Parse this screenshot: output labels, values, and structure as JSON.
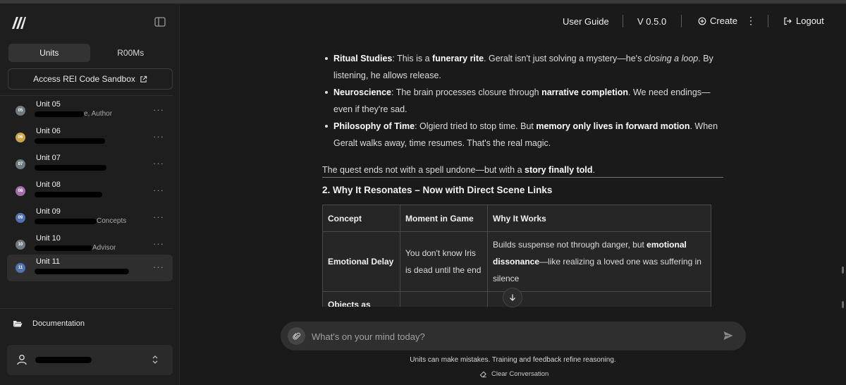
{
  "sidebar": {
    "tabs": [
      "Units",
      "R00Ms"
    ],
    "sandbox_label": "Access REI Code Sandbox",
    "units": [
      {
        "badge": "05",
        "name": "Unit 05",
        "subtitle": "e, Author",
        "color": "#6f7b80"
      },
      {
        "badge": "06",
        "name": "Unit 06",
        "subtitle": "",
        "color": "#c9a64a"
      },
      {
        "badge": "07",
        "name": "Unit 07",
        "subtitle": "",
        "color": "#6f7b80"
      },
      {
        "badge": "08",
        "name": "Unit 08",
        "subtitle": "",
        "color": "#a46fa8"
      },
      {
        "badge": "09",
        "name": "Unit 09",
        "subtitle": "Concepts",
        "color": "#4f74b0"
      },
      {
        "badge": "10",
        "name": "Unit 10",
        "subtitle": "Advisor",
        "color": "#6f7b80"
      },
      {
        "badge": "11",
        "name": "Unit 11",
        "subtitle": "",
        "color": "#4f74b0"
      }
    ],
    "documentation_label": "Documentation"
  },
  "nav": {
    "user_guide": "User Guide",
    "version": "V 0.5.0",
    "create": "Create",
    "logout": "Logout"
  },
  "content": {
    "bullets": [
      {
        "term": "Ritual Studies",
        "t1": ": This is a ",
        "b1": "funerary rite",
        "t2": ". Geralt isn't just solving a mystery—he's ",
        "i1": "closing a loop",
        "t3": ". By listening, he allows release."
      },
      {
        "term": "Neuroscience",
        "t1": ": The brain processes closure through ",
        "b1": "narrative completion",
        "t2": ". We need endings—even if they're sad."
      },
      {
        "term": "Philosophy of Time",
        "t1": ": Olgierd tried to stop time. But ",
        "b1": "memory only lives in forward motion",
        "t2": ". When Geralt walks away, time resumes. That's the real magic."
      }
    ],
    "closing_text": "The quest ends not with a spell undone—but with a ",
    "closing_bold": "story finally told",
    "closing_end": ".",
    "heading": "2. Why It Resonates – Now with Direct Scene Links",
    "table": {
      "headers": [
        "Concept",
        "Moment in Game",
        "Why It Works"
      ],
      "rows": [
        {
          "concept": "Emotional Delay",
          "moment": "You don't know Iris is dead until the end",
          "why_pre": "Builds suspense not through danger, but ",
          "why_bold": "emotional dissonance",
          "why_post": "—like realizing a loved one was suffering in silence"
        },
        {
          "concept": "Objects as",
          "moment": "",
          "why_pre": "",
          "why_bold": "",
          "why_post": ""
        }
      ]
    }
  },
  "composer": {
    "placeholder": "What's on your mind today?",
    "disclaimer": "Units can make mistakes. Training and feedback refine reasoning.",
    "clear_label": "Clear Conversation"
  }
}
